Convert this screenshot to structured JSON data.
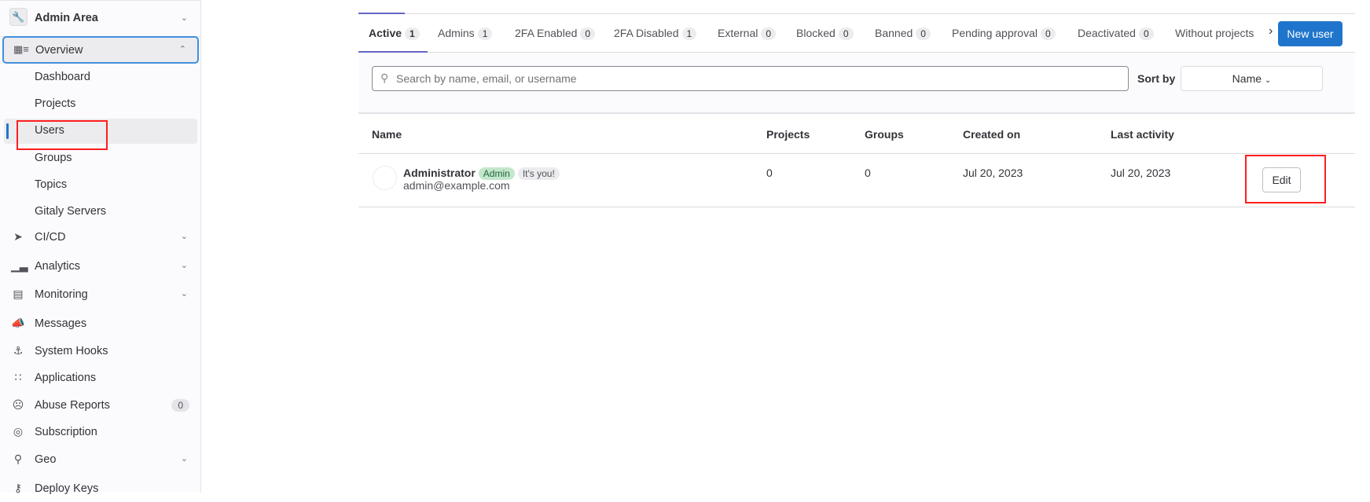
{
  "sidebar": {
    "header": "Admin Area",
    "overview": "Overview",
    "sub_items": [
      "Dashboard",
      "Projects",
      "Users",
      "Groups",
      "Topics",
      "Gitaly Servers"
    ],
    "items": [
      {
        "label": "CI/CD",
        "icon": "rocket-icon",
        "chevron": true
      },
      {
        "label": "Analytics",
        "icon": "chart-icon",
        "chevron": true
      },
      {
        "label": "Monitoring",
        "icon": "monitor-icon",
        "chevron": true
      },
      {
        "label": "Messages",
        "icon": "bullhorn-icon"
      },
      {
        "label": "System Hooks",
        "icon": "anchor-icon"
      },
      {
        "label": "Applications",
        "icon": "applications-icon"
      },
      {
        "label": "Abuse Reports",
        "icon": "sad-face-icon",
        "count": "0"
      },
      {
        "label": "Subscription",
        "icon": "license-icon"
      },
      {
        "label": "Geo",
        "icon": "location-icon",
        "chevron": true
      },
      {
        "label": "Deploy Keys",
        "icon": "key-icon"
      }
    ]
  },
  "tabs": [
    {
      "label": "Active",
      "count": "1"
    },
    {
      "label": "Admins",
      "count": "1"
    },
    {
      "label": "2FA Enabled",
      "count": "0"
    },
    {
      "label": "2FA Disabled",
      "count": "1"
    },
    {
      "label": "External",
      "count": "0"
    },
    {
      "label": "Blocked",
      "count": "0"
    },
    {
      "label": "Banned",
      "count": "0"
    },
    {
      "label": "Pending approval",
      "count": "0"
    },
    {
      "label": "Deactivated",
      "count": "0"
    },
    {
      "label": "Without projects",
      "count": ""
    }
  ],
  "new_user": "New user",
  "search": {
    "placeholder": "Search by name, email, or username"
  },
  "sort": {
    "label": "Sort by",
    "value": "Name"
  },
  "table": {
    "headers": [
      "Name",
      "Projects",
      "Groups",
      "Created on",
      "Last activity"
    ],
    "rows": [
      {
        "name": "Administrator",
        "badge_admin": "Admin",
        "badge_you": "It's you!",
        "email": "admin@example.com",
        "projects": "0",
        "groups": "0",
        "created": "Jul 20, 2023",
        "last_activity": "Jul 20, 2023",
        "action": "Edit"
      }
    ]
  },
  "colors": {
    "primary": "#1f75cb",
    "tab_active": "#6666c4",
    "annotation": "#ff1e1e",
    "admin_badge": "#c3e6cd"
  }
}
